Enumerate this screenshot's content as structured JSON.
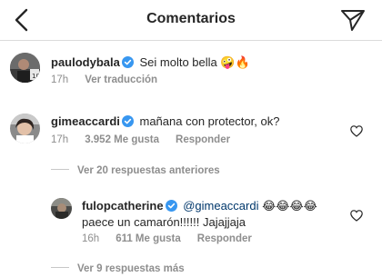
{
  "header": {
    "title": "Comentarios",
    "back_icon": "chevron-left-icon",
    "share_icon": "paper-plane-icon"
  },
  "comments": [
    {
      "username": "paulodybala",
      "verified": true,
      "text": "Sei molto bella",
      "emojis": "🤪🔥",
      "time": "17h",
      "action": "Ver traducción"
    },
    {
      "username": "gimeaccardi",
      "verified": true,
      "text": "mañana con protector, ok?",
      "time": "17h",
      "likes": "3.952 Me gusta",
      "reply": "Responder",
      "previous_replies": "Ver 20 respuestas anteriores"
    },
    {
      "username": "fulopcatherine",
      "verified": true,
      "mention": "@gimeaccardi",
      "emojis": "😂😂😂😂",
      "text2": "paece un camarón!!!!!! Jajajjaja",
      "time": "16h",
      "likes": "611 Me gusta",
      "reply": "Responder",
      "more_replies": "Ver 9 respuestas más"
    }
  ],
  "colors": {
    "verified": "#3897f0",
    "text": "#262626",
    "secondary": "#8e8e8e",
    "mention": "#00376b"
  }
}
